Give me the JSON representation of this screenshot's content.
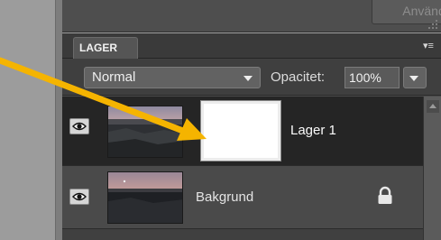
{
  "upper_panel": {
    "apply_label": "Använd"
  },
  "panel": {
    "tab_label": "LAGER",
    "menu_icon": "panel-menu-icon",
    "blend_mode": "Normal",
    "opacity_label": "Opacitet:",
    "opacity_value": "100%"
  },
  "layers": [
    {
      "name": "Lager 1",
      "selected": true,
      "visible": true,
      "has_mask": true,
      "locked": false
    },
    {
      "name": "Bakgrund",
      "selected": false,
      "visible": true,
      "has_mask": false,
      "locked": true
    }
  ],
  "annotation": {
    "arrow_color": "#f5b400"
  }
}
